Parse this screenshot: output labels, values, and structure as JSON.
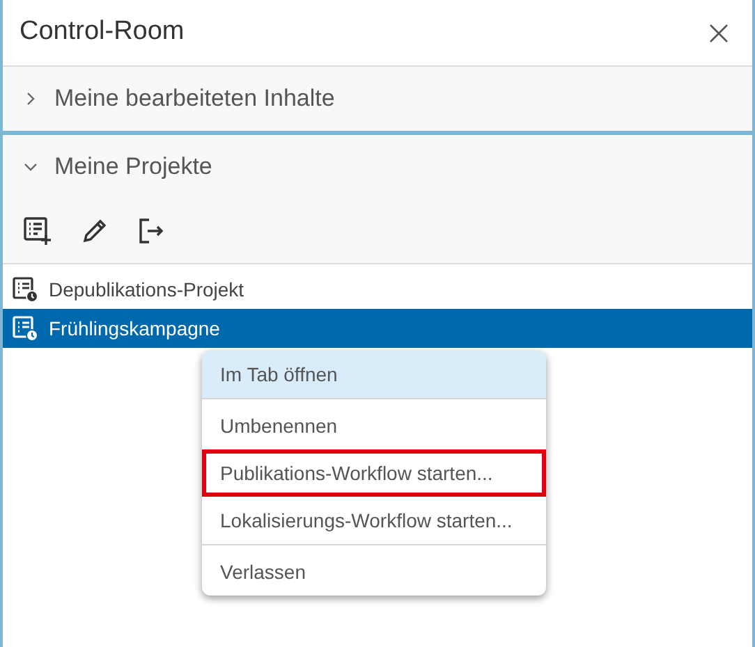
{
  "window": {
    "title": "Control-Room"
  },
  "sections": [
    {
      "title": "Meine bearbeiteten Inhalte",
      "expanded": false
    },
    {
      "title": "Meine Projekte",
      "expanded": true
    }
  ],
  "projects": [
    {
      "name": "Depublikations-Projekt",
      "selected": false
    },
    {
      "name": "Frühlingskampagne",
      "selected": true
    }
  ],
  "context_menu": {
    "groups": [
      [
        {
          "label": "Im Tab öffnen",
          "selected": true,
          "highlighted": false
        }
      ],
      [
        {
          "label": "Umbenennen",
          "selected": false,
          "highlighted": false
        },
        {
          "label": "Publikations-Workflow starten...",
          "selected": false,
          "highlighted": true
        },
        {
          "label": "Lokalisierungs-Workflow starten...",
          "selected": false,
          "highlighted": false
        }
      ],
      [
        {
          "label": "Verlassen",
          "selected": false,
          "highlighted": false
        }
      ]
    ]
  }
}
